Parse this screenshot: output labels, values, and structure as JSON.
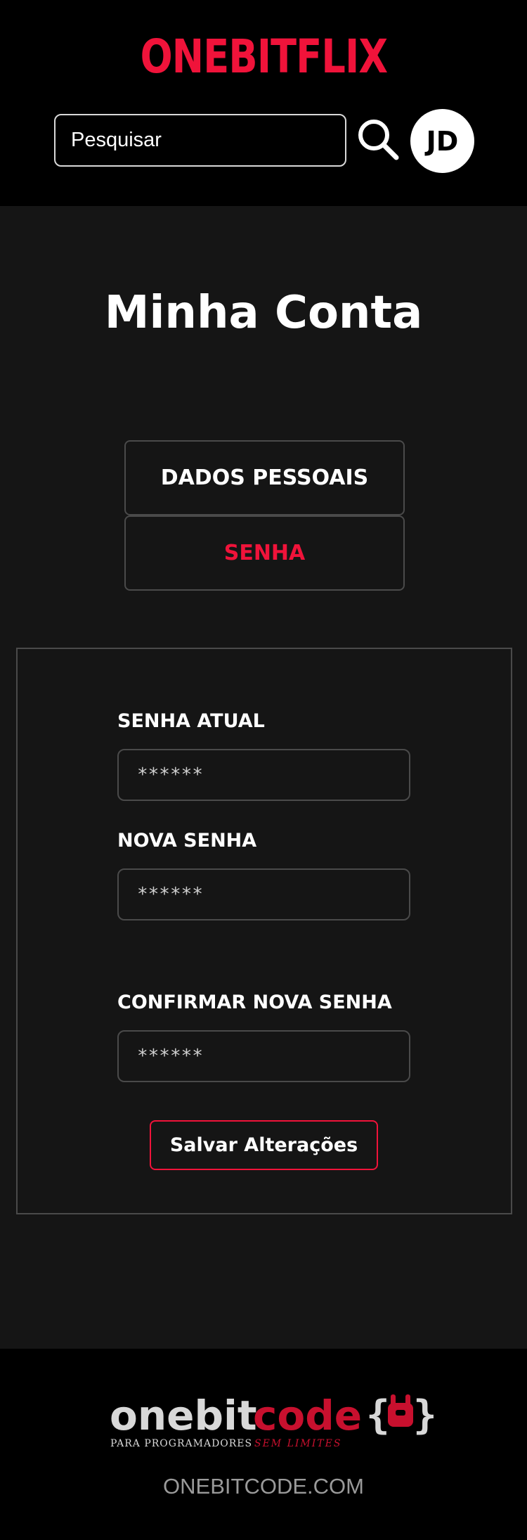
{
  "header": {
    "brand": "ONEBITFLIX",
    "search_placeholder": "Pesquisar",
    "avatar_initials": "JD"
  },
  "main": {
    "title": "Minha Conta",
    "tabs": [
      {
        "label": "DADOS PESSOAIS",
        "active": false
      },
      {
        "label": "SENHA",
        "active": true
      }
    ],
    "form": {
      "current_password_label": "SENHA ATUAL",
      "current_password_placeholder": "******",
      "new_password_label": "NOVA SENHA",
      "new_password_placeholder": "******",
      "confirm_password_label": "CONFIRMAR NOVA SENHA",
      "confirm_password_placeholder": "******",
      "save_label": "Salvar Alterações"
    }
  },
  "footer": {
    "logo_word_1": "onebit",
    "logo_word_2": "code",
    "tagline_1": "PARA PROGRAMADORES",
    "tagline_2": "SEM LIMITES",
    "link": "ONEBITCODE.COM"
  },
  "colors": {
    "accent": "#f0133a",
    "background": "#151515",
    "header_bg": "#000000",
    "border": "#4a4a4a"
  }
}
